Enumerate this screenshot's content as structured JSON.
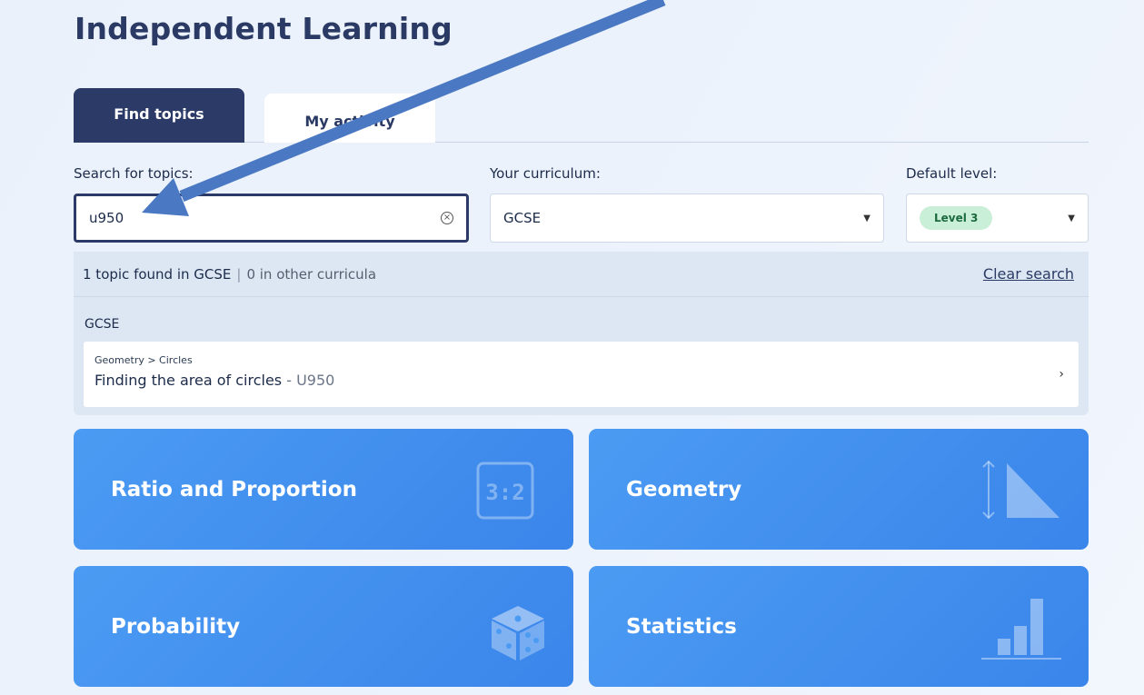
{
  "page": {
    "title": "Independent Learning"
  },
  "tabs": [
    {
      "label": "Find topics",
      "active": true
    },
    {
      "label": "My activity",
      "active": false
    }
  ],
  "filters": {
    "search_label": "Search for topics:",
    "search_value": "u950",
    "curriculum_label": "Your curriculum:",
    "curriculum_value": "GCSE",
    "level_label": "Default level:",
    "level_value": "Level 3"
  },
  "results": {
    "summary_main": "1 topic found in GCSE",
    "summary_separator": "|",
    "summary_other": "0 in other curricula",
    "clear_label": "Clear search",
    "group": "GCSE",
    "item": {
      "breadcrumb": "Geometry > Circles",
      "title": "Finding the area of circles",
      "code": "- U950"
    }
  },
  "topics": [
    {
      "label": "Ratio and Proportion",
      "icon": "ratio-icon",
      "icon_text": "3:2"
    },
    {
      "label": "Geometry",
      "icon": "geometry-icon"
    },
    {
      "label": "Probability",
      "icon": "dice-icon"
    },
    {
      "label": "Statistics",
      "icon": "bar-chart-icon"
    }
  ],
  "colors": {
    "navy": "#2b3a67",
    "card_blue": "#4b9bf3",
    "badge_green": "#c9efd9",
    "annotation_arrow": "#4a78c2"
  }
}
